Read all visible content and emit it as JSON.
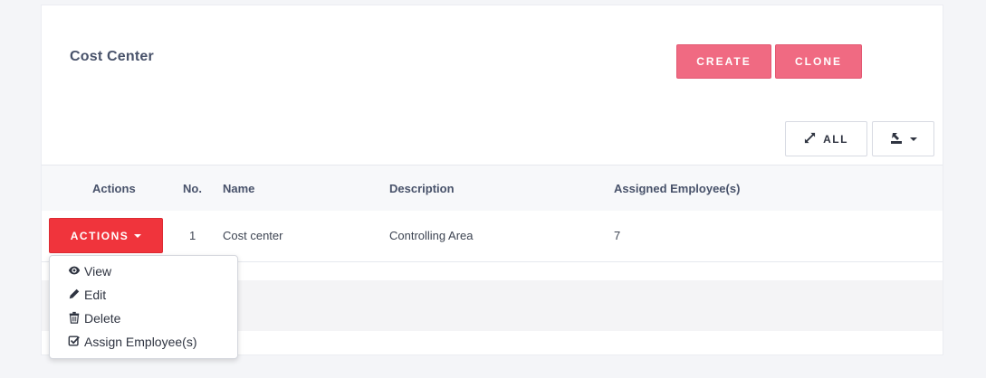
{
  "page": {
    "title": "Cost Center",
    "create_label": "CREATE",
    "clone_label": "CLONE",
    "expand_all_label": "ALL"
  },
  "icons": {
    "expand": "expand-arrows-icon",
    "export": "export-icon",
    "view": "eye-icon",
    "edit": "pencil-icon",
    "delete": "trash-icon",
    "assign": "check-square-icon"
  },
  "colors": {
    "create_button": "#f06a82",
    "actions_button": "#f0343c",
    "title": "#48526a"
  },
  "table": {
    "headers": {
      "actions": "Actions",
      "no": "No.",
      "name": "Name",
      "description": "Description",
      "assigned": "Assigned Employee(s)"
    },
    "rows": [
      {
        "actions_label": "ACTIONS",
        "no": "1",
        "name": "Cost center",
        "description": "Controlling Area",
        "assigned": "7"
      }
    ]
  },
  "dropdown": {
    "items": [
      {
        "label": "View"
      },
      {
        "label": "Edit"
      },
      {
        "label": "Delete"
      },
      {
        "label": "Assign Employee(s)"
      }
    ]
  }
}
